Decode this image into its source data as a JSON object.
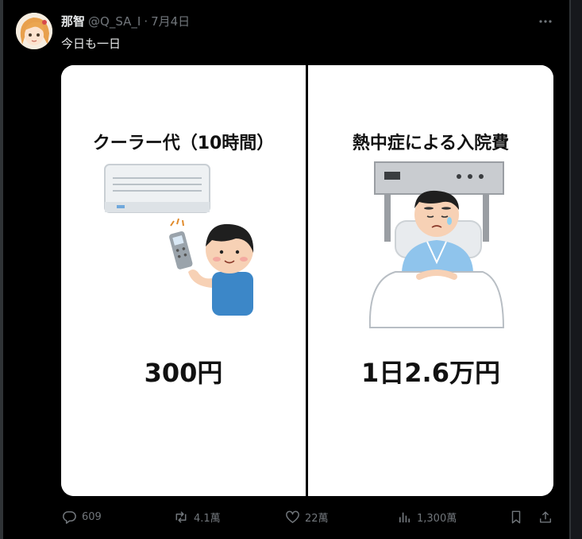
{
  "post": {
    "author_name": "那智",
    "handle": "@Q_SA_I",
    "separator": "·",
    "date": "7月4日",
    "text": "今日も一日"
  },
  "media": {
    "left": {
      "title": "クーラー代（10時間）",
      "price": "300円"
    },
    "right": {
      "title": "熱中症による入院費",
      "price": "1日2.6万円"
    }
  },
  "actions": {
    "replies": "609",
    "reposts": "4.1萬",
    "likes": "22萬",
    "views": "1,300萬"
  },
  "colors": {
    "background": "#000000",
    "text_primary": "#e7e9ea",
    "text_secondary": "#71767b",
    "media_bg": "#ffffff"
  },
  "icons": {
    "more": "more-icon",
    "reply": "reply-icon",
    "repost": "repost-icon",
    "like": "heart-icon",
    "views": "views-icon",
    "bookmark": "bookmark-icon",
    "share": "share-icon"
  }
}
